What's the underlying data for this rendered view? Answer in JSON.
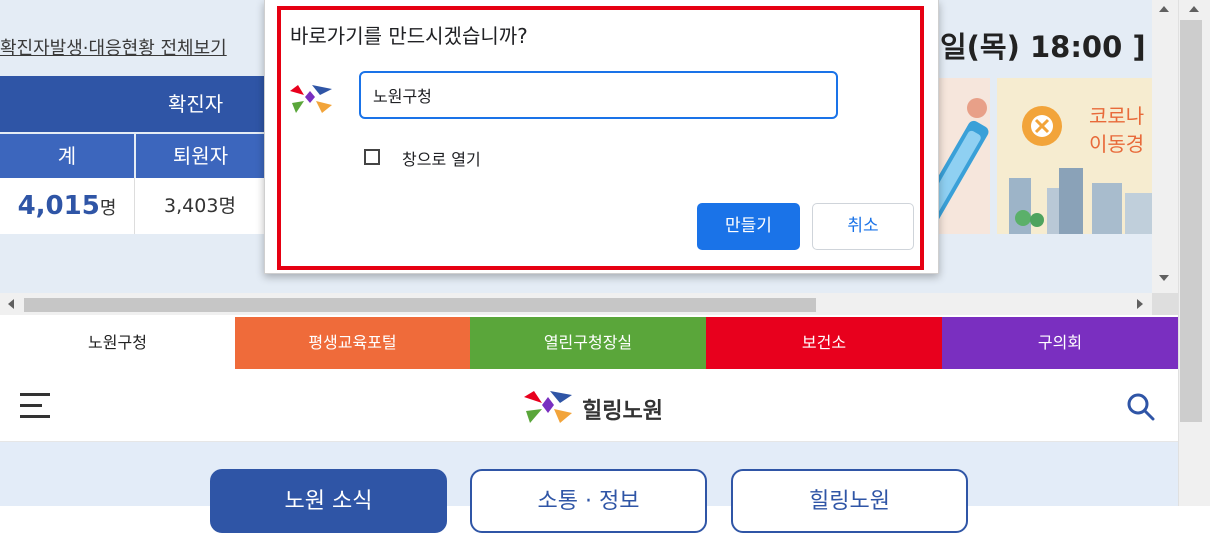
{
  "frame": {
    "title": "확진자발생·대응현황 전체보기",
    "date": "일(목) 18:00 ]",
    "stats": {
      "header": "확진자",
      "columns": [
        "계",
        "퇴원자"
      ],
      "values": [
        {
          "number": "4,015",
          "unit": "명"
        },
        {
          "number": "3,403",
          "unit": "명"
        }
      ]
    },
    "thumb2": {
      "line1": "코로나",
      "line2": "이동경"
    }
  },
  "dialog": {
    "title": "바로가기를 만드시겠습니까?",
    "name_value": "노원구청",
    "open_as_window_label": "창으로 열기",
    "open_as_window_checked": false,
    "create_label": "만들기",
    "cancel_label": "취소"
  },
  "site": {
    "tabs": [
      {
        "label": "노원구청",
        "color": "#ffffff",
        "text_color": "#222222"
      },
      {
        "label": "평생교육포털",
        "color": "#ef6b3a",
        "text_color": "#ffffff"
      },
      {
        "label": "열린구청장실",
        "color": "#5aa63a",
        "text_color": "#ffffff"
      },
      {
        "label": "보건소",
        "color": "#e8001d",
        "text_color": "#ffffff"
      },
      {
        "label": "구의회",
        "color": "#7a2fc0",
        "text_color": "#ffffff"
      }
    ],
    "logo_text": "힐링노원",
    "nav": [
      "노원 소식",
      "소통 · 정보",
      "힐링노원"
    ]
  },
  "colors": {
    "accent": "#1a73e8",
    "highlight": "#e60012",
    "brand_blue": "#2f55a6"
  }
}
